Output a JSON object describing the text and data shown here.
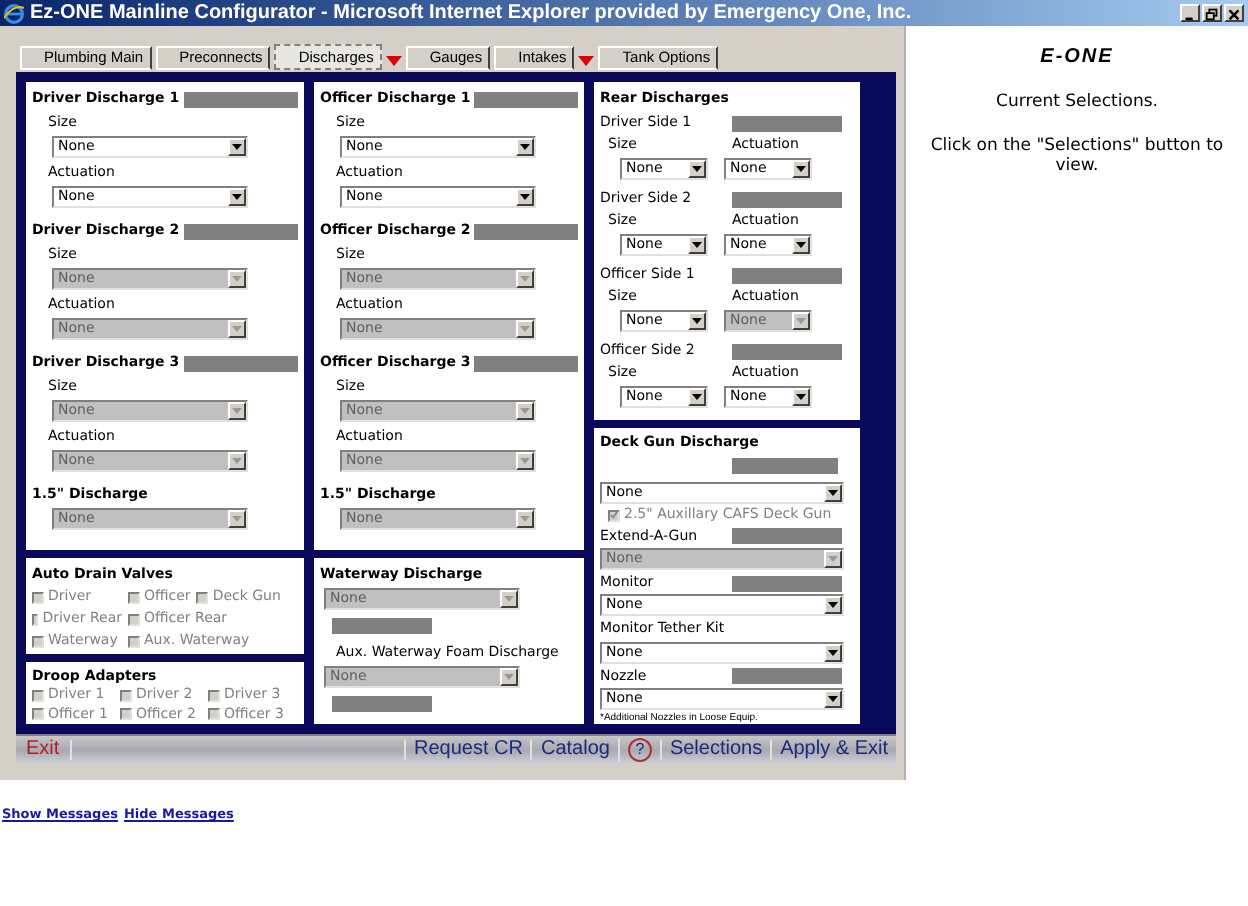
{
  "window": {
    "title": "Ez-ONE Mainline Configurator - Microsoft Internet Explorer provided by Emergency One, Inc."
  },
  "tabs": [
    {
      "label": "Plumbing Main",
      "selected": false,
      "flagged": false
    },
    {
      "label": "Preconnects",
      "selected": false,
      "flagged": false
    },
    {
      "label": "Discharges",
      "selected": true,
      "flagged": false
    },
    {
      "label": "Gauges",
      "selected": false,
      "flagged": true
    },
    {
      "label": "Intakes",
      "selected": false,
      "flagged": false
    },
    {
      "label": "Tank Options",
      "selected": false,
      "flagged": true
    }
  ],
  "columns": [
    [
      {
        "rows": [
          {
            "kind": "heading",
            "text": "Driver Discharge 1",
            "bar": true
          },
          {
            "kind": "label",
            "text": "Size"
          },
          {
            "kind": "select",
            "value": "None",
            "disabled": false
          },
          {
            "kind": "label",
            "text": "Actuation"
          },
          {
            "kind": "select",
            "value": "None",
            "disabled": false
          },
          {
            "kind": "heading",
            "text": "Driver Discharge 2",
            "bar": true
          },
          {
            "kind": "label",
            "text": "Size"
          },
          {
            "kind": "select",
            "value": "None",
            "disabled": true
          },
          {
            "kind": "label",
            "text": "Actuation"
          },
          {
            "kind": "select",
            "value": "None",
            "disabled": true
          },
          {
            "kind": "heading",
            "text": "Driver Discharge 3",
            "bar": true
          },
          {
            "kind": "label",
            "text": "Size"
          },
          {
            "kind": "select",
            "value": "None",
            "disabled": true
          },
          {
            "kind": "label",
            "text": "Actuation"
          },
          {
            "kind": "select",
            "value": "None",
            "disabled": true
          },
          {
            "kind": "heading",
            "text": "1.5\" Discharge",
            "bar": false
          },
          {
            "kind": "select",
            "value": "None",
            "disabled": true
          }
        ]
      },
      {
        "rows": [
          {
            "kind": "heading",
            "text": "Auto Drain Valves",
            "bar": false
          },
          {
            "kind": "checks",
            "items": [
              {
                "label": "Driver",
                "checked": false,
                "disabled": true
              },
              {
                "label": "Officer",
                "checked": false,
                "disabled": true
              },
              {
                "label": "Deck Gun",
                "checked": false,
                "disabled": true
              }
            ]
          },
          {
            "kind": "checks",
            "items": [
              {
                "label": "Driver Rear",
                "checked": false,
                "disabled": true
              },
              {
                "label": "Officer Rear",
                "checked": false,
                "disabled": true
              }
            ]
          },
          {
            "kind": "checks",
            "items": [
              {
                "label": "Waterway",
                "checked": false,
                "disabled": true
              },
              {
                "label": "Aux. Waterway",
                "checked": false,
                "disabled": true
              }
            ]
          }
        ]
      },
      {
        "rows": [
          {
            "kind": "heading",
            "text": "Droop Adapters",
            "bar": false
          },
          {
            "kind": "checks",
            "items": [
              {
                "label": "Driver 1",
                "checked": false,
                "disabled": true
              },
              {
                "label": "Driver 2",
                "checked": false,
                "disabled": true
              },
              {
                "label": "Driver 3",
                "checked": false,
                "disabled": true
              }
            ]
          },
          {
            "kind": "checks",
            "items": [
              {
                "label": "Officer 1",
                "checked": false,
                "disabled": true
              },
              {
                "label": "Officer 2",
                "checked": false,
                "disabled": true
              },
              {
                "label": "Officer 3",
                "checked": false,
                "disabled": true
              }
            ]
          }
        ]
      }
    ],
    [
      {
        "rows": [
          {
            "kind": "heading",
            "text": "Officer Discharge 1",
            "bar": true
          },
          {
            "kind": "label",
            "text": "Size"
          },
          {
            "kind": "select",
            "value": "None",
            "disabled": false
          },
          {
            "kind": "label",
            "text": "Actuation"
          },
          {
            "kind": "select",
            "value": "None",
            "disabled": false
          },
          {
            "kind": "heading",
            "text": "Officer Discharge 2",
            "bar": true
          },
          {
            "kind": "label",
            "text": "Size"
          },
          {
            "kind": "select",
            "value": "None",
            "disabled": true
          },
          {
            "kind": "label",
            "text": "Actuation"
          },
          {
            "kind": "select",
            "value": "None",
            "disabled": true
          },
          {
            "kind": "heading",
            "text": "Officer Discharge 3",
            "bar": true
          },
          {
            "kind": "label",
            "text": "Size"
          },
          {
            "kind": "select",
            "value": "None",
            "disabled": true
          },
          {
            "kind": "label",
            "text": "Actuation"
          },
          {
            "kind": "select",
            "value": "None",
            "disabled": true
          },
          {
            "kind": "heading",
            "text": "1.5\" Discharge",
            "bar": false
          },
          {
            "kind": "select",
            "value": "None",
            "disabled": true
          }
        ]
      },
      {
        "rows": [
          {
            "kind": "heading",
            "text": "Waterway Discharge",
            "bar": false
          },
          {
            "kind": "select",
            "value": "None",
            "disabled": true
          },
          {
            "kind": "bar"
          },
          {
            "kind": "label",
            "text": "Aux. Waterway Foam Discharge"
          },
          {
            "kind": "select",
            "value": "None",
            "disabled": true
          },
          {
            "kind": "bar"
          }
        ]
      }
    ],
    [
      {
        "rows": [
          {
            "kind": "heading",
            "text": "Rear Discharges",
            "bar": false
          },
          {
            "kind": "label",
            "text": "Driver Side 1",
            "bar": true
          },
          {
            "kind": "label_pair",
            "labels": [
              "Size",
              "Actuation"
            ]
          },
          {
            "kind": "select_pair",
            "selects": [
              {
                "value": "None",
                "disabled": false
              },
              {
                "value": "None",
                "disabled": false
              }
            ]
          },
          {
            "kind": "label",
            "text": "Driver Side 2",
            "bar": true
          },
          {
            "kind": "label_pair",
            "labels": [
              "Size",
              "Actuation"
            ]
          },
          {
            "kind": "select_pair",
            "selects": [
              {
                "value": "None",
                "disabled": false
              },
              {
                "value": "None",
                "disabled": false
              }
            ]
          },
          {
            "kind": "label",
            "text": "Officer Side 1",
            "bar": true
          },
          {
            "kind": "label_pair",
            "labels": [
              "Size",
              "Actuation"
            ]
          },
          {
            "kind": "select_pair",
            "selects": [
              {
                "value": "None",
                "disabled": false
              },
              {
                "value": "None",
                "disabled": true
              }
            ]
          },
          {
            "kind": "label",
            "text": "Officer Side 2",
            "bar": true
          },
          {
            "kind": "label_pair",
            "labels": [
              "Size",
              "Actuation"
            ]
          },
          {
            "kind": "select_pair",
            "selects": [
              {
                "value": "None",
                "disabled": false
              },
              {
                "value": "None",
                "disabled": false
              }
            ]
          }
        ]
      },
      {
        "rows": [
          {
            "kind": "heading",
            "text": "Deck Gun Discharge",
            "bar": false
          },
          {
            "kind": "bar"
          },
          {
            "kind": "select",
            "value": "None",
            "disabled": false
          },
          {
            "kind": "checks",
            "items": [
              {
                "label": "2.5\" Auxillary CAFS Deck Gun",
                "checked": true,
                "disabled": true
              }
            ]
          },
          {
            "kind": "label",
            "text": "Extend-A-Gun",
            "bar": true
          },
          {
            "kind": "select",
            "value": "None",
            "disabled": true
          },
          {
            "kind": "label",
            "text": "Monitor",
            "bar": true
          },
          {
            "kind": "select",
            "value": "None",
            "disabled": false
          },
          {
            "kind": "label",
            "text": "Monitor Tether Kit",
            "bar": false
          },
          {
            "kind": "select",
            "value": "None",
            "disabled": false
          },
          {
            "kind": "label",
            "text": "Nozzle",
            "bar": true
          },
          {
            "kind": "select",
            "value": "None",
            "disabled": false
          },
          {
            "kind": "note",
            "text": "*Additional Nozzles in Loose Equip."
          }
        ]
      }
    ]
  ],
  "bottom_bar": [
    {
      "kind": "exit",
      "label": "Exit"
    },
    {
      "kind": "link",
      "label": "Request CR"
    },
    {
      "kind": "link",
      "label": "Catalog"
    },
    {
      "kind": "help",
      "label": "?"
    },
    {
      "kind": "link",
      "label": "Selections"
    },
    {
      "kind": "link",
      "label": "Apply & Exit"
    }
  ],
  "side_panel": {
    "logo": "E-ONE",
    "title": "Current Selections.",
    "text": "Click on the \"Selections\" button to view."
  },
  "message_links": [
    "Show Messages",
    "Hide Messages"
  ]
}
